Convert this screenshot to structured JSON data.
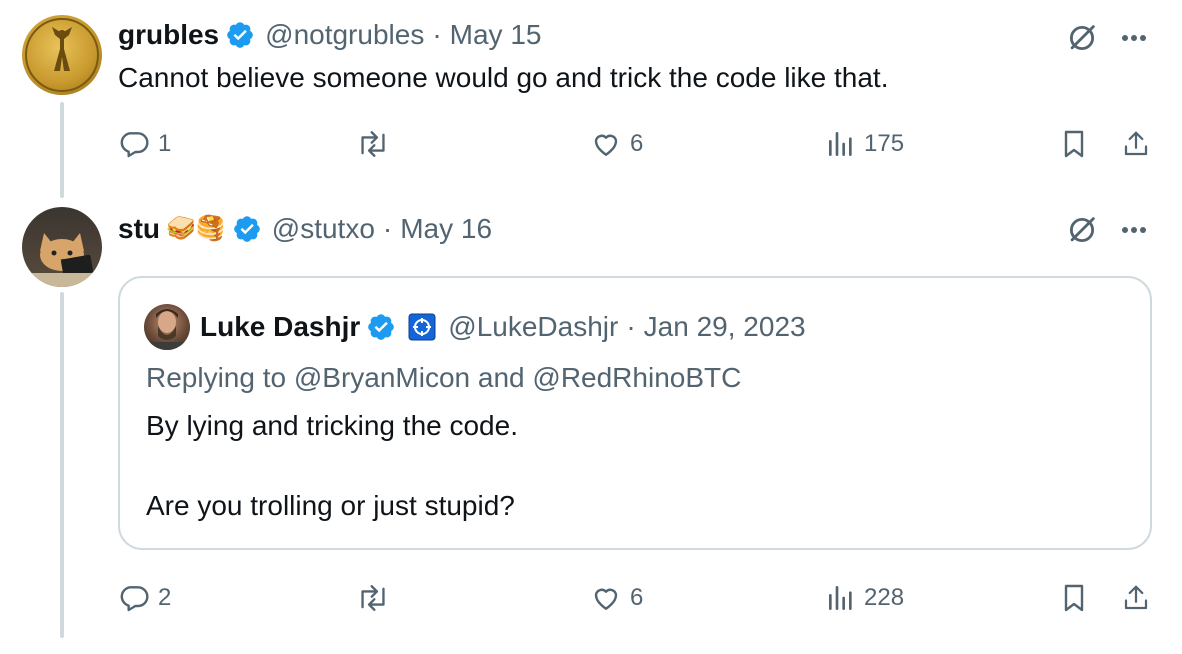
{
  "tweets": [
    {
      "display_name": "grubles",
      "handle": "@notgrubles",
      "sep": "·",
      "date": "May 15",
      "text": "Cannot believe someone would go and trick the code like that.",
      "replies": "1",
      "likes": "6",
      "views": "175"
    },
    {
      "display_name": "stu",
      "emoji": "🥪🥞",
      "handle": "@stutxo",
      "sep": "·",
      "date": "May 16",
      "replies": "2",
      "likes": "6",
      "views": "228",
      "quote": {
        "display_name": "Luke Dashjr",
        "handle": "@LukeDashjr",
        "sep": "·",
        "date": "Jan 29, 2023",
        "replying_to": "Replying to @BryanMicon and @RedRhinoBTC",
        "line1": "By lying and tricking the code.",
        "line2": "Are you trolling or just stupid?"
      }
    }
  ],
  "colors": {
    "verified": "#1d9bf0",
    "muted": "#536471",
    "border": "#cfd9de"
  },
  "icons": [
    "grok-icon",
    "more-icon",
    "reply-icon",
    "retweet-icon",
    "like-icon",
    "views-icon",
    "bookmark-icon",
    "share-icon",
    "verified-icon"
  ]
}
